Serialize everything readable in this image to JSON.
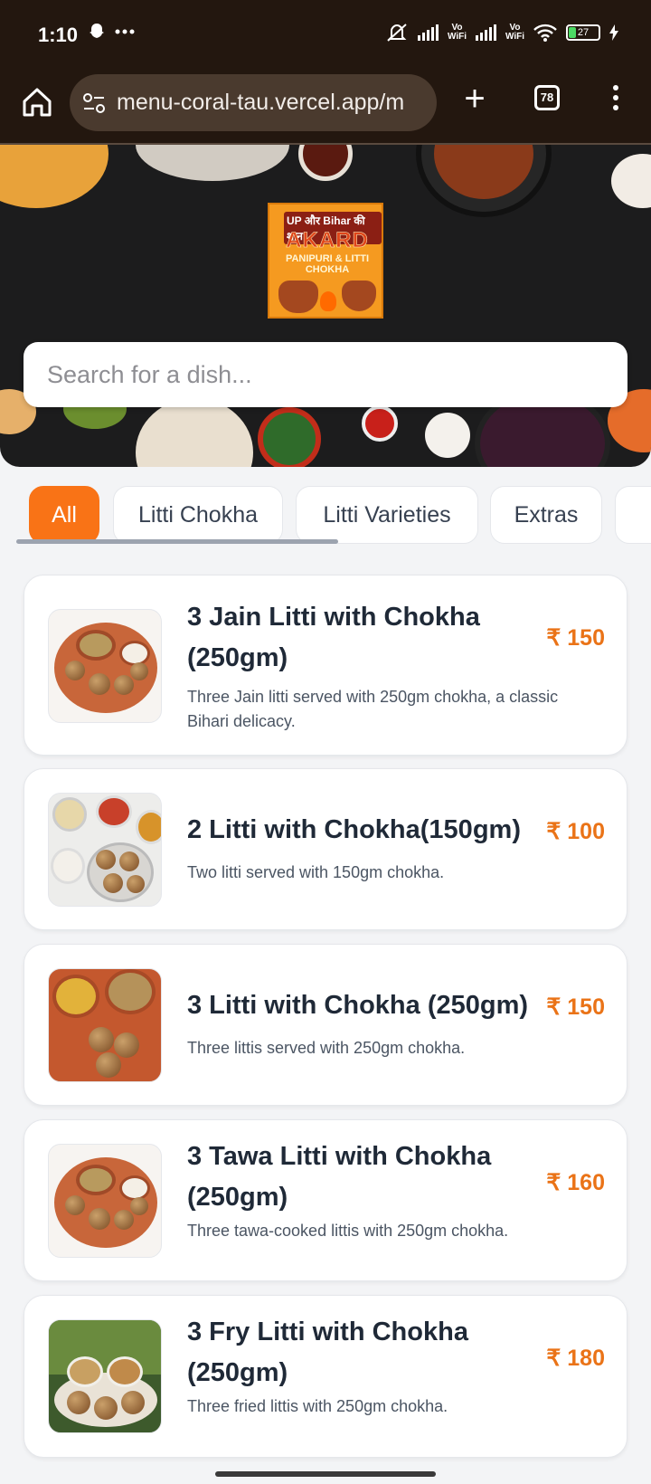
{
  "status_bar": {
    "time": "1:10",
    "battery": "27"
  },
  "browser": {
    "url": "menu-coral-tau.vercel.app/m",
    "tab_count": "78"
  },
  "hero": {
    "logo_line1": "UP और Bihar की शान",
    "logo_line2": "AKARD",
    "logo_line3": "PANIPURI & LITTI CHOKHA",
    "search_placeholder": "Search for a dish..."
  },
  "categories": [
    {
      "label": "All",
      "active": true
    },
    {
      "label": "Litti Chokha",
      "active": false
    },
    {
      "label": "Litti Varieties",
      "active": false
    },
    {
      "label": "Extras",
      "active": false
    }
  ],
  "menu_items": [
    {
      "name": "3 Jain Litti with Chokha (250gm)",
      "description": "Three Jain litti served with 250gm chokha, a classic Bihari delicacy.",
      "price": "₹ 150"
    },
    {
      "name": "2 Litti with Chokha(150gm)",
      "description": "Two litti served with 150gm chokha.",
      "price": "₹ 100"
    },
    {
      "name": "3 Litti with Chokha (250gm)",
      "description": "Three littis served with 250gm chokha.",
      "price": "₹ 150"
    },
    {
      "name": "3 Tawa Litti with Chokha (250gm)",
      "description": "Three tawa-cooked littis with 250gm chokha.",
      "price": "₹ 160"
    },
    {
      "name": "3 Fry Litti with Chokha (250gm)",
      "description": "Three fried littis with 250gm chokha.",
      "price": "₹ 180"
    }
  ],
  "colors": {
    "accent": "#f97316",
    "price": "#ea7317",
    "status_bar_bg": "#23170f"
  }
}
